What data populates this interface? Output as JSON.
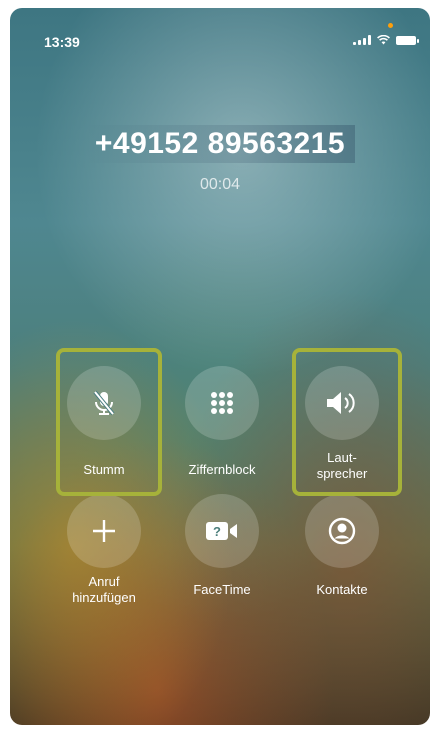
{
  "status": {
    "time": "13:39"
  },
  "call": {
    "number": "+49152 89563215",
    "duration": "00:04"
  },
  "buttons": {
    "mute": "Stumm",
    "keypad": "Ziffernblock",
    "speaker_line1": "Laut-",
    "speaker_line2": "sprecher",
    "add_line1": "Anruf",
    "add_line2": "hinzufügen",
    "facetime": "FaceTime",
    "contacts": "Kontakte"
  },
  "colors": {
    "highlight": "#a6b23a",
    "indicator": "#ff9f0a"
  }
}
